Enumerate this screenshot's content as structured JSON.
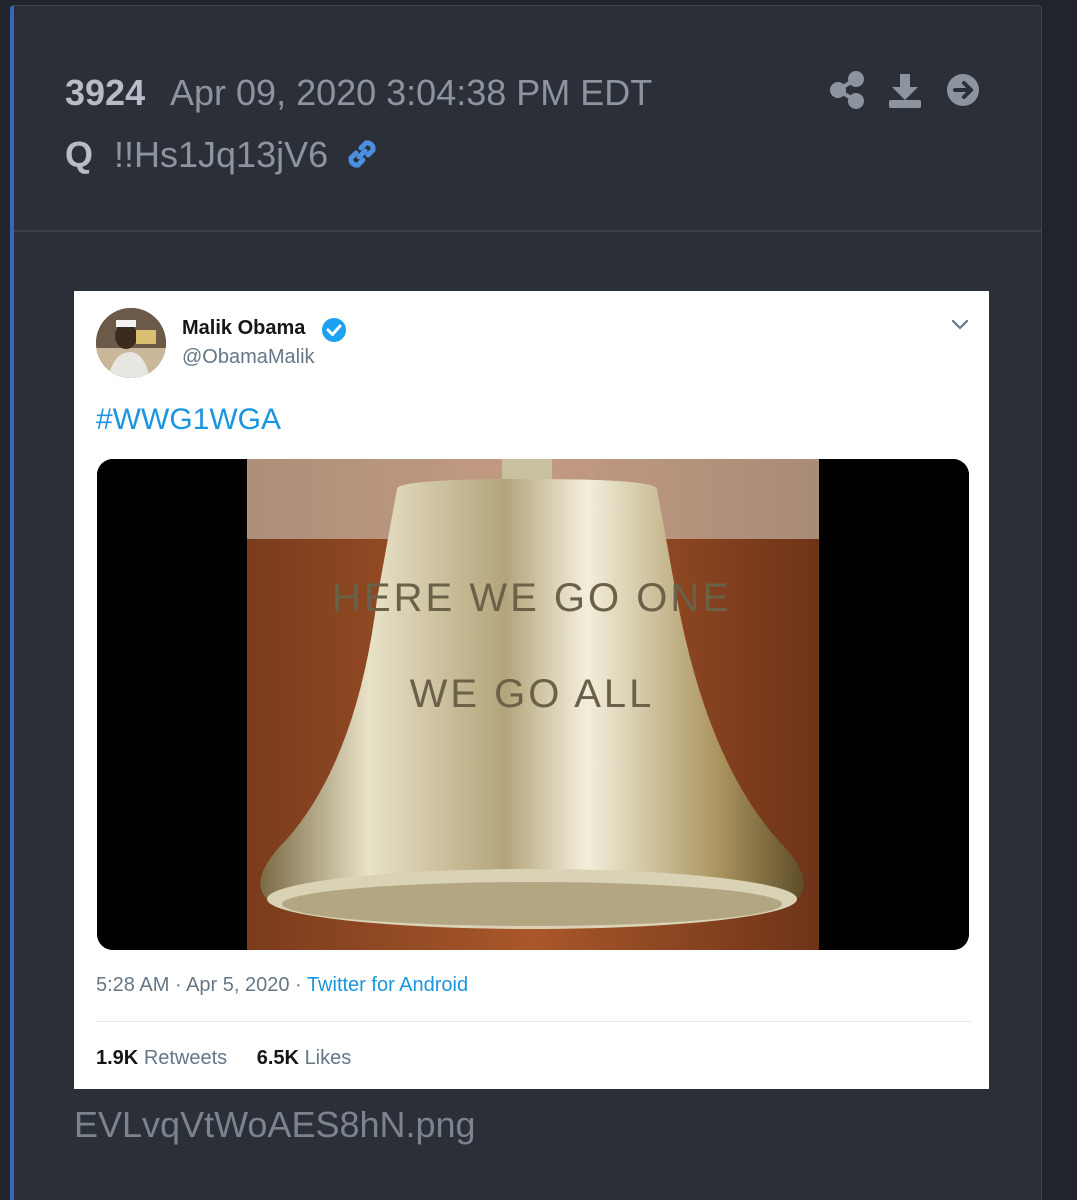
{
  "post": {
    "number": "3924",
    "date": "Apr 09, 2020 3:04:38 PM EDT",
    "author": "Q",
    "tripcode": "!!Hs1Jq13jV6",
    "icons": [
      "link-icon",
      "share-icon",
      "download-icon",
      "next-arrow-icon"
    ]
  },
  "tweet": {
    "author_name": "Malik Obama",
    "handle": "@ObamaMalik",
    "hashtag": "#WWG1WGA",
    "image_text_line1": "HERE WE GO ONE",
    "image_text_line2": "WE GO ALL",
    "time": "5:28 AM",
    "date": "Apr 5, 2020",
    "separator": "·",
    "source": "Twitter for Android",
    "retweets_count": "1.9K",
    "retweets_label": "Retweets",
    "likes_count": "6.5K",
    "likes_label": "Likes"
  },
  "attachment": {
    "filename": "EVLvqVtWoAES8hN.png"
  },
  "colors": {
    "page_bg": "#21242b",
    "card_bg": "#2b2f38",
    "accent_link": "#4a8fe2",
    "twitter_blue": "#1b95e0"
  }
}
